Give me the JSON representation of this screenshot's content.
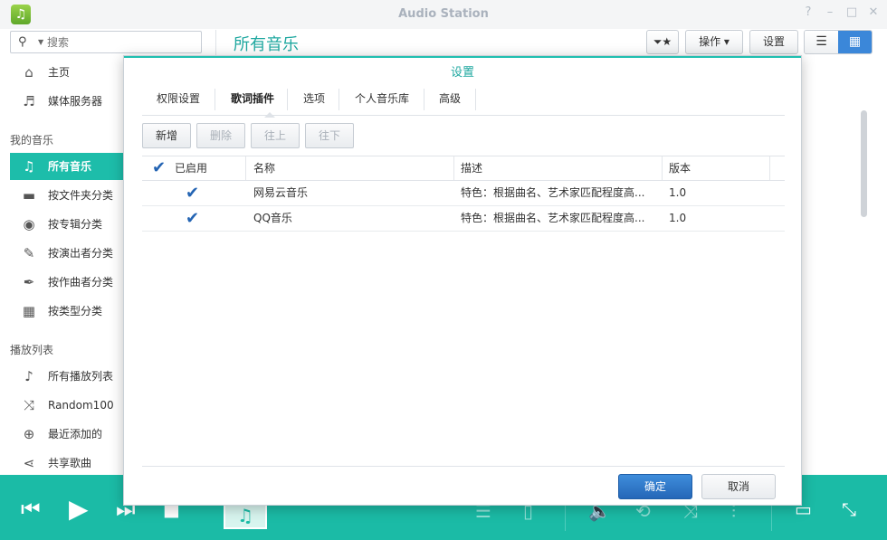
{
  "window": {
    "title": "Audio Station",
    "controls": [
      "?",
      "–",
      "□",
      "✕"
    ]
  },
  "toolbar": {
    "search_placeholder": "搜索",
    "heading": "所有音乐",
    "ops_label": "操作 ▾",
    "settings_label": "设置"
  },
  "sidebar": {
    "top_items": [
      {
        "label": "主页",
        "icon": "home-icon"
      },
      {
        "label": "媒体服务器",
        "icon": "media-server-icon"
      }
    ],
    "my_music_label": "我的音乐",
    "music_items": [
      {
        "label": "所有音乐",
        "icon": "music-note-icon"
      },
      {
        "label": "按文件夹分类",
        "icon": "folder-icon"
      },
      {
        "label": "按专辑分类",
        "icon": "album-icon"
      },
      {
        "label": "按演出者分类",
        "icon": "microphone-icon"
      },
      {
        "label": "按作曲者分类",
        "icon": "pen-icon"
      },
      {
        "label": "按类型分类",
        "icon": "grid-icon"
      }
    ],
    "playlist_label": "播放列表",
    "playlist_items": [
      {
        "label": "所有播放列表",
        "icon": "playlist-icon"
      },
      {
        "label": "Random100",
        "icon": "shuffle-icon"
      },
      {
        "label": "最近添加的",
        "icon": "plus-circle-icon"
      },
      {
        "label": "共享歌曲",
        "icon": "share-icon"
      }
    ]
  },
  "dialog": {
    "title": "设置",
    "tabs": [
      "权限设置",
      "歌词插件",
      "选项",
      "个人音乐库",
      "高级"
    ],
    "active_tab": "歌词插件",
    "actions": {
      "add": "新增",
      "delete": "删除",
      "up": "往上",
      "down": "往下"
    },
    "columns": {
      "enabled": "已启用",
      "name": "名称",
      "description": "描述",
      "version": "版本"
    },
    "rows": [
      {
        "enabled": true,
        "name": "网易云音乐",
        "description": "特色：根据曲名、艺术家匹配程度高...",
        "version": "1.0"
      },
      {
        "enabled": true,
        "name": "QQ音乐",
        "description": "特色：根据曲名、艺术家匹配程度高...",
        "version": "1.0"
      }
    ],
    "ok_label": "确定",
    "cancel_label": "取消"
  },
  "colors": {
    "accent": "#1bbba6",
    "primary_button": "#2a6fc2",
    "view_toggle_active": "#3b87d9"
  }
}
